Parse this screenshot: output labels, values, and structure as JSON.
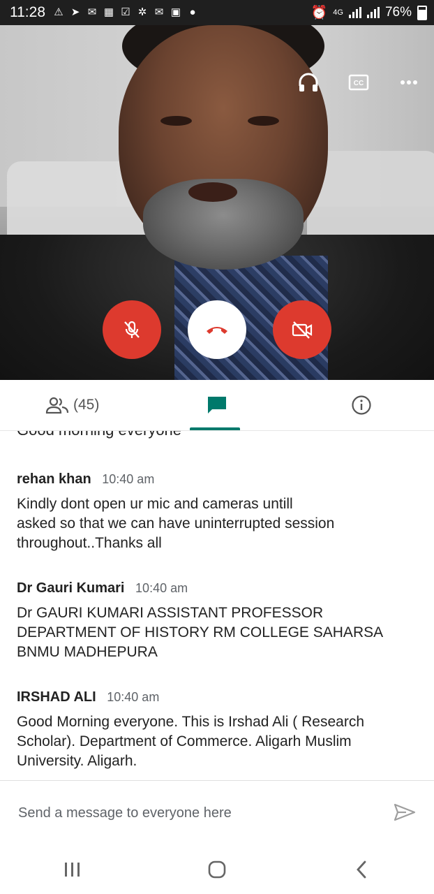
{
  "status_bar": {
    "time": "11:28",
    "network": "4G",
    "battery": "76%",
    "notification_icons": [
      "warning-icon",
      "telegram-icon",
      "gmail-icon",
      "image-icon",
      "checkbox-icon",
      "settings-icon",
      "mail-icon",
      "gallery-icon",
      "chat-icon"
    ]
  },
  "call": {
    "top_controls": [
      "headphones-icon",
      "captions-icon",
      "more-icon"
    ],
    "mic_state": "muted",
    "camera_state": "off",
    "colors": {
      "danger": "#dd3a2e",
      "accent": "#00796b"
    }
  },
  "tabs": {
    "people_count": "(45)",
    "active": "chat"
  },
  "chat": {
    "previous_partial": "Good morning everyone",
    "messages": [
      {
        "sender": "rehan khan",
        "time": "10:40 am",
        "lines": [
          "Kindly dont open ur mic and cameras untill",
          "asked so that we can have uninterrupted session",
          "throughout..Thanks all"
        ]
      },
      {
        "sender": "Dr Gauri Kumari",
        "time": "10:40 am",
        "lines": [
          "Dr GAURI KUMARI ASSISTANT PROFESSOR",
          "DEPARTMENT OF HISTORY RM COLLEGE SAHARSA",
          "BNMU MADHEPURA"
        ]
      },
      {
        "sender": "IRSHAD ALI",
        "time": "10:40 am",
        "lines": [
          "Good Morning everyone. This is Irshad Ali ( Research",
          "Scholar). Department of Commerce. Aligarh Muslim",
          "University. Aligarh."
        ]
      }
    ]
  },
  "composer": {
    "placeholder": "Send a message to everyone here"
  }
}
